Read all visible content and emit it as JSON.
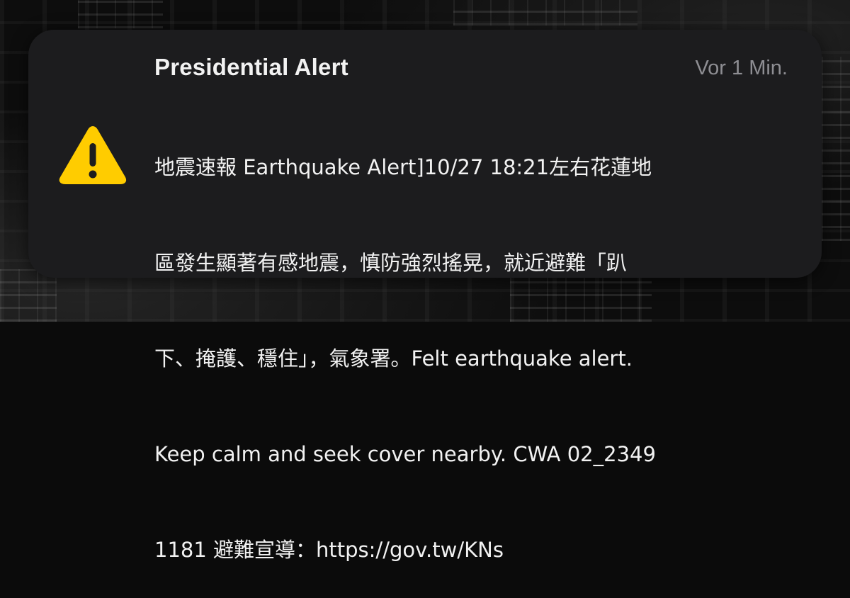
{
  "notification": {
    "title": "Presidential Alert",
    "timestamp": "Vor 1 Min.",
    "icon": "warning-triangle-icon",
    "body_lines": [
      "地震速報 Earthquake Alert]10/27 18:21左右花蓮地",
      "區發生顯著有感地震，慎防強烈搖晃，就近避難「趴",
      "下、掩護、穩住」，氣象署。Felt earthquake alert.",
      "Keep calm and seek cover nearby. CWA 02_2349",
      "1181 避難宣導：https://gov.tw/KNs"
    ]
  },
  "colors": {
    "card_background": "#1c1c1e",
    "title_text": "#f2f2f2",
    "timestamp_text": "#8e8e93",
    "warning_yellow": "#ffcc00"
  }
}
